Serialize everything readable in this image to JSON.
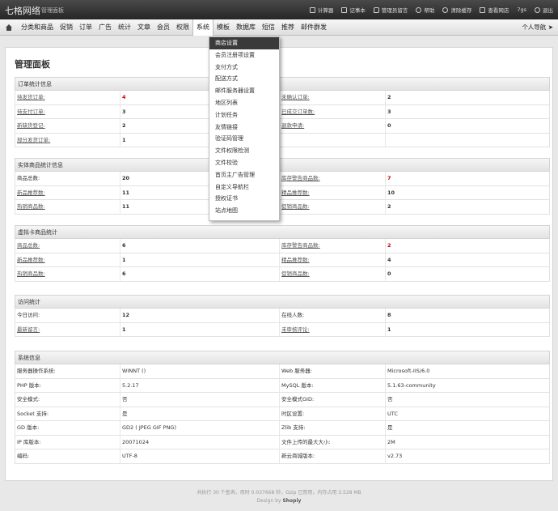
{
  "app": {
    "brand": "七格网络",
    "subtitle": "管理面板"
  },
  "top_links": [
    {
      "label": "计算器",
      "icon": "calculator-icon"
    },
    {
      "label": "记事本",
      "icon": "notepad-icon"
    },
    {
      "label": "管理员留言",
      "icon": "chat-icon"
    },
    {
      "label": "帮助",
      "icon": "help-icon"
    },
    {
      "label": "清除缓存",
      "icon": "refresh-icon"
    },
    {
      "label": "查看网店",
      "icon": "store-icon"
    },
    {
      "label": "7gs",
      "icon": ""
    },
    {
      "label": "退出",
      "icon": "power-icon"
    }
  ],
  "nav": {
    "items": [
      "分类和商品",
      "促销",
      "订单",
      "广告",
      "统计",
      "文章",
      "会员",
      "权限",
      "系统",
      "模板",
      "数据库",
      "短信",
      "推荐",
      "邮件群发"
    ],
    "active": "系统",
    "right_label": "个人导航"
  },
  "dropdown": {
    "selected": "商店设置",
    "items": [
      "商店设置",
      "会员注册项设置",
      "支付方式",
      "配送方式",
      "邮件服务器设置",
      "地区列表",
      "计划任务",
      "友情链接",
      "验证码管理",
      "文件权限检测",
      "文件校验",
      "首页主广告管理",
      "自定义导航栏",
      "授权证书",
      "站点地图"
    ]
  },
  "page_title": "管理面板",
  "sections": [
    {
      "title": "订单统计信息",
      "rows": [
        [
          {
            "t": "待发货订单:",
            "link": true
          },
          {
            "t": "4",
            "red": true
          },
          {
            "t": "未确认订单:",
            "link": true
          },
          {
            "t": "2"
          }
        ],
        [
          {
            "t": "待支付订单:",
            "link": true
          },
          {
            "t": "3"
          },
          {
            "t": "已成交订单数:",
            "link": true
          },
          {
            "t": "3"
          }
        ],
        [
          {
            "t": "新缺货登记:",
            "link": true
          },
          {
            "t": "2"
          },
          {
            "t": "退款申请:",
            "link": true
          },
          {
            "t": "0"
          }
        ],
        [
          {
            "t": "部分发货订单:",
            "link": true
          },
          {
            "t": "1"
          },
          {
            "t": ""
          },
          {
            "t": ""
          }
        ]
      ]
    },
    {
      "title": "实体商品统计信息",
      "rows": [
        [
          {
            "t": "商品总数:"
          },
          {
            "t": "20"
          },
          {
            "t": "库存警告商品数:",
            "link": true
          },
          {
            "t": "7",
            "red": true
          }
        ],
        [
          {
            "t": "新品推荐数:",
            "link": true
          },
          {
            "t": "11"
          },
          {
            "t": "精品推荐数:",
            "link": true
          },
          {
            "t": "10"
          }
        ],
        [
          {
            "t": "热销商品数:",
            "link": true
          },
          {
            "t": "11"
          },
          {
            "t": "促销商品数:",
            "link": true
          },
          {
            "t": "2"
          }
        ]
      ]
    },
    {
      "title": "虚拟卡商品统计",
      "rows": [
        [
          {
            "t": "商品总数:",
            "link": true
          },
          {
            "t": "6"
          },
          {
            "t": "库存警告商品数:",
            "link": true
          },
          {
            "t": "2",
            "red": true
          }
        ],
        [
          {
            "t": "新品推荐数:",
            "link": true
          },
          {
            "t": "1"
          },
          {
            "t": "精品推荐数:",
            "link": true
          },
          {
            "t": "4"
          }
        ],
        [
          {
            "t": "热销商品数:",
            "link": true
          },
          {
            "t": "6"
          },
          {
            "t": "促销商品数:",
            "link": true
          },
          {
            "t": "0"
          }
        ]
      ]
    },
    {
      "title": "访问统计",
      "rows": [
        [
          {
            "t": "今日访问:"
          },
          {
            "t": "12"
          },
          {
            "t": "在线人数:"
          },
          {
            "t": "8"
          }
        ],
        [
          {
            "t": "最新留言:",
            "link": true
          },
          {
            "t": "1"
          },
          {
            "t": "未审核评论:",
            "link": true
          },
          {
            "t": "1"
          }
        ]
      ]
    },
    {
      "title": "系统信息",
      "plain": true,
      "rows": [
        [
          {
            "t": "服务器操作系统:"
          },
          {
            "t": "WINNT ()"
          },
          {
            "t": "Web 服务器:"
          },
          {
            "t": "Microsoft-IIS/6.0"
          }
        ],
        [
          {
            "t": "PHP 版本:"
          },
          {
            "t": "5.2.17"
          },
          {
            "t": "MySQL 版本:"
          },
          {
            "t": "5.1.63-community"
          }
        ],
        [
          {
            "t": "安全模式:"
          },
          {
            "t": "否"
          },
          {
            "t": "安全模式GID:"
          },
          {
            "t": "否"
          }
        ],
        [
          {
            "t": "Socket 支持:"
          },
          {
            "t": "是"
          },
          {
            "t": "时区设置:"
          },
          {
            "t": "UTC"
          }
        ],
        [
          {
            "t": "GD 版本:"
          },
          {
            "t": "GD2 ( JPEG GIF PNG)"
          },
          {
            "t": "Zlib 支持:"
          },
          {
            "t": "是"
          }
        ],
        [
          {
            "t": "IP 库版本:"
          },
          {
            "t": "20071024"
          },
          {
            "t": "文件上传的最大大小:"
          },
          {
            "t": "2M"
          }
        ],
        [
          {
            "t": "编码:"
          },
          {
            "t": "UTF-8"
          },
          {
            "t": "新云商城版本:"
          },
          {
            "t": "v2.73"
          }
        ]
      ]
    }
  ],
  "footer": {
    "stats": "共执行 30 个查询，用时 0.037668 秒，Gzip 已禁用，内存占用 3.528 MB",
    "design_prefix": "Design by ",
    "design_brand": "Shopiy"
  }
}
